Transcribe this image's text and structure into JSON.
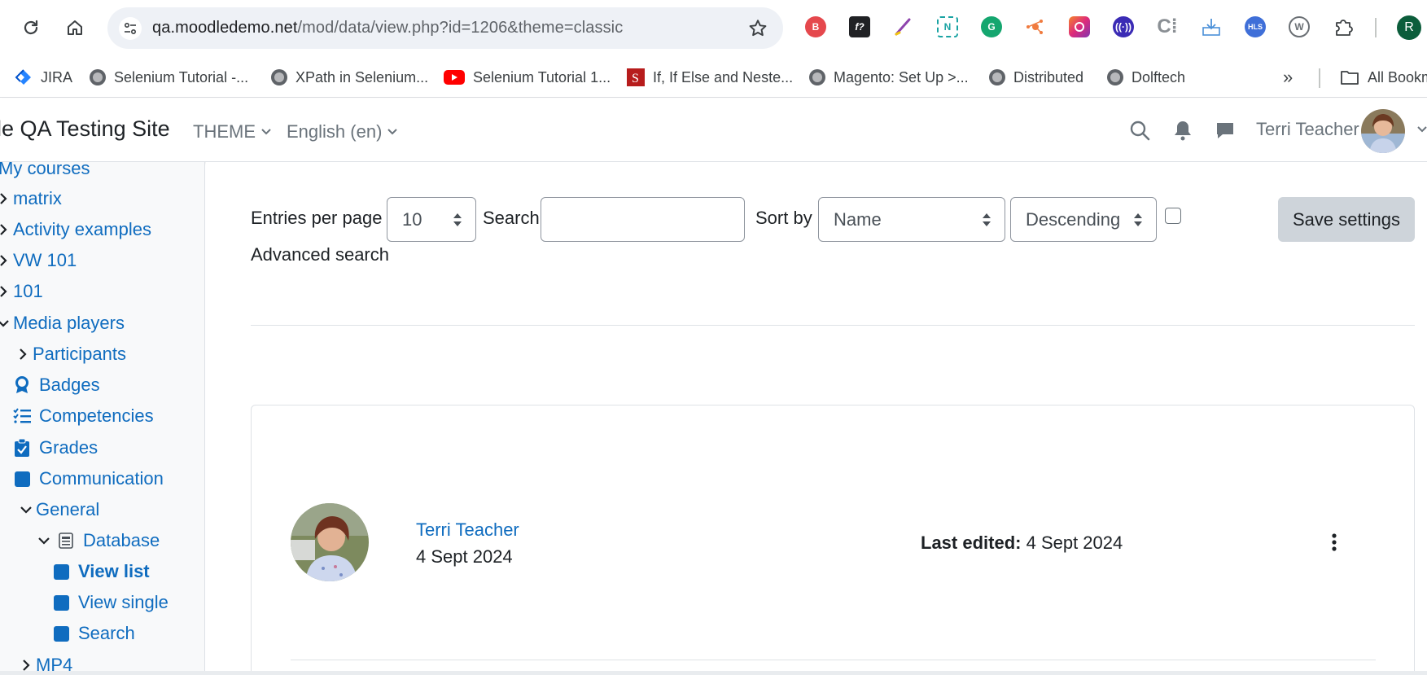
{
  "browser": {
    "url_host": "qa.moodledemo.net",
    "url_path": "/mod/data/view.php?id=1206&theme=classic",
    "profile_initial": "R",
    "bookmarks": [
      {
        "label": "JIRA",
        "icon": "jira-icon"
      },
      {
        "label": "Selenium Tutorial -...",
        "icon": "globe-icon"
      },
      {
        "label": "XPath in Selenium...",
        "icon": "globe-icon"
      },
      {
        "label": "Selenium Tutorial 1...",
        "icon": "youtube-icon"
      },
      {
        "label": "If, If Else and Neste...",
        "icon": "scribd-icon"
      },
      {
        "label": "Magento: Set Up >...",
        "icon": "globe-icon"
      },
      {
        "label": "Distributed",
        "icon": "globe-icon"
      },
      {
        "label": "Dolftech",
        "icon": "globe-icon"
      }
    ],
    "all_bookmarks_label": "All Bookm"
  },
  "navbar": {
    "site_name": "lle QA Testing Site",
    "theme_menu": "THEME",
    "language_menu": "English (en)",
    "user_name": "Terri Teacher"
  },
  "drawer": {
    "items": [
      {
        "label": "My courses"
      },
      {
        "label": "matrix"
      },
      {
        "label": "Activity examples"
      },
      {
        "label": "VW 101"
      },
      {
        "label": "101"
      },
      {
        "label": "Media players"
      },
      {
        "label": "Participants"
      },
      {
        "label": "Badges"
      },
      {
        "label": "Competencies"
      },
      {
        "label": "Grades"
      },
      {
        "label": "Communication"
      },
      {
        "label": "General"
      },
      {
        "label": "Database"
      },
      {
        "label": "View list"
      },
      {
        "label": "View single"
      },
      {
        "label": "Search"
      },
      {
        "label": "MP4"
      }
    ]
  },
  "controls": {
    "entries_per_page_label": "Entries per page",
    "entries_per_page_value": "10",
    "search_label": "Search",
    "search_value": "",
    "sort_by_label": "Sort by",
    "sort_by_value": "Name",
    "order_value": "Descending",
    "save_label": "Save settings",
    "advanced_search_label": "Advanced search"
  },
  "entry": {
    "author": "Terri Teacher",
    "date": "4 Sept 2024",
    "last_edited_label": "Last edited:",
    "last_edited_value": "4 Sept 2024"
  }
}
